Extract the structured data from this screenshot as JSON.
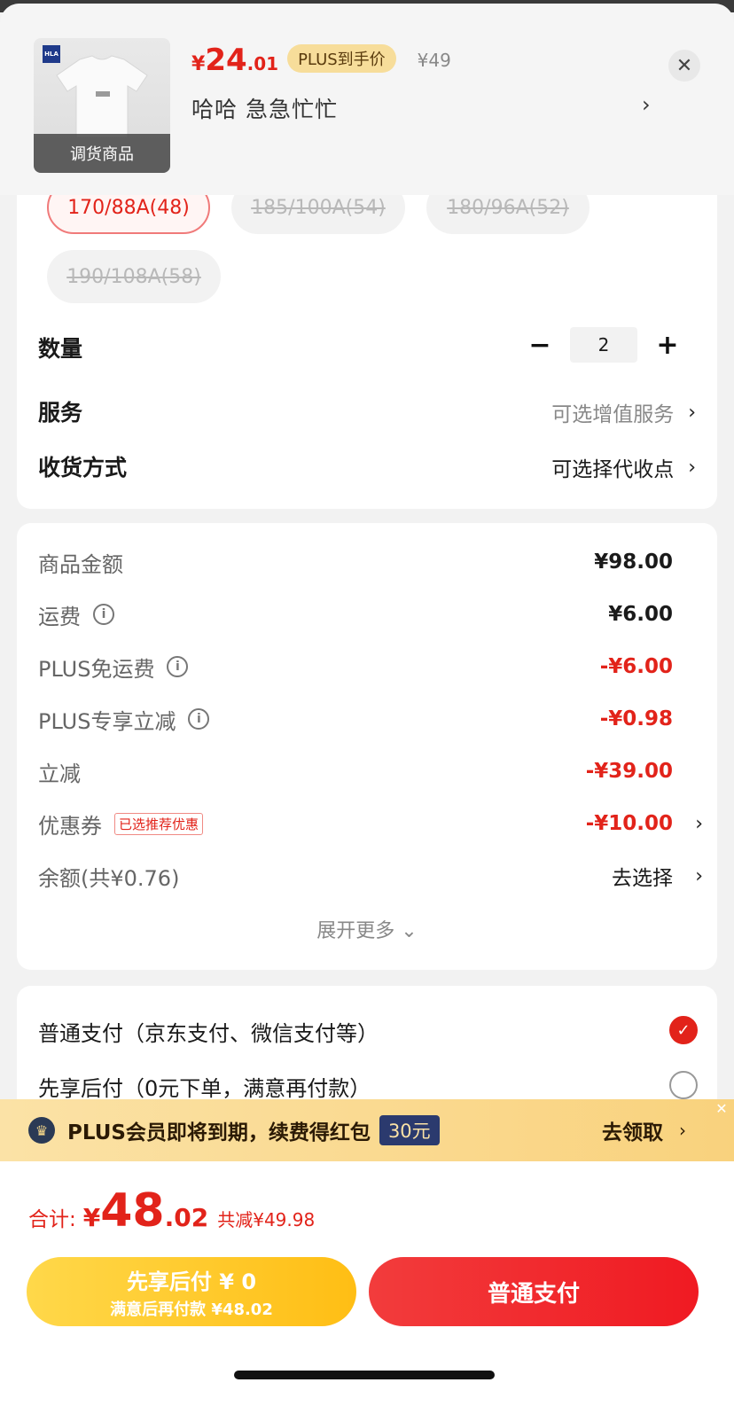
{
  "product": {
    "price_symbol": "¥",
    "price_int": "24",
    "price_dec": ".01",
    "plus_badge": "PLUS到手价",
    "original_price": "¥49",
    "title": "哈哈  急急忙忙",
    "thumb_tag": "调货商品",
    "brand": "HLA"
  },
  "sizes": [
    {
      "label": "170/88A(48)",
      "state": "selected"
    },
    {
      "label": "185/100A(54)",
      "state": "disabled"
    },
    {
      "label": "180/96A(52)",
      "state": "disabled"
    },
    {
      "label": "190/108A(58)",
      "state": "disabled"
    }
  ],
  "quantity": {
    "label": "数量",
    "value": "2",
    "minus": "−",
    "plus": "+"
  },
  "service": {
    "label": "服务",
    "value": "可选增值服务"
  },
  "delivery": {
    "label": "收货方式",
    "value": "可选择代收点"
  },
  "fees": {
    "goods": {
      "label": "商品金额",
      "value": "¥98.00"
    },
    "shipping": {
      "label": "运费",
      "value": "¥6.00"
    },
    "plus_free_shipping": {
      "label": "PLUS免运费",
      "value": "-¥6.00"
    },
    "plus_discount": {
      "label": "PLUS专享立减",
      "value": "-¥0.98"
    },
    "instant_discount": {
      "label": "立减",
      "value": "-¥39.00"
    },
    "coupon": {
      "label": "优惠券",
      "tag": "已选推荐优惠",
      "value": "-¥10.00"
    },
    "balance": {
      "label": "余额(共¥0.76)",
      "value": "去选择"
    },
    "expand": "展开更多"
  },
  "payment": {
    "normal": "普通支付（京东支付、微信支付等）",
    "later": "先享后付（0元下单，满意再付款）"
  },
  "plus_banner": {
    "text": "PLUS会员即将到期，续费得红包",
    "amount": "30元",
    "cta": "去领取"
  },
  "total": {
    "label": "合计:",
    "symbol": "¥",
    "int": "48",
    "dec": ".02",
    "saved": "共减¥49.98"
  },
  "buttons": {
    "later_line1": "先享后付 ¥ 0",
    "later_line2": "满意后再付款 ¥48.02",
    "pay": "普通支付"
  },
  "colors": {
    "accent_red": "#e2231a",
    "plus_gold": "#f9d27d",
    "later_yellow": "#ffc21c"
  }
}
